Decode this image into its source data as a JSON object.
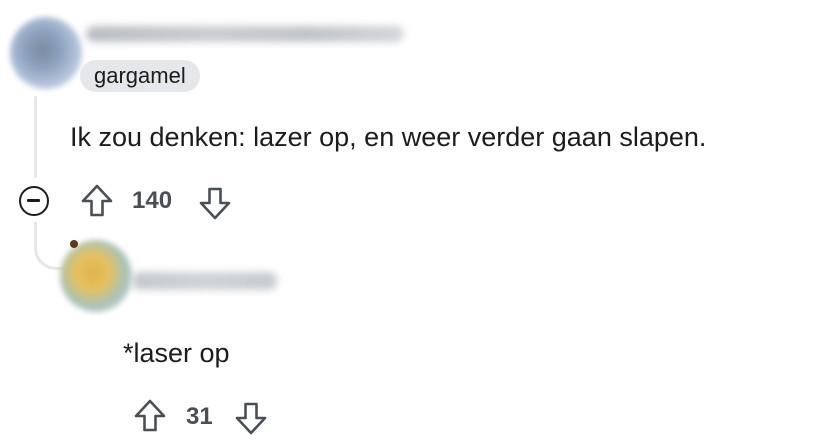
{
  "comments": [
    {
      "flair": "gargamel",
      "text": "Ik zou denken: lazer op, en weer verder gaan slapen.",
      "score": "140",
      "icons": {
        "upvote": "upvote-arrow-icon",
        "downvote": "downvote-arrow-icon",
        "collapse": "minus-circle-icon"
      }
    },
    {
      "text": "*laser op",
      "score": "31",
      "icons": {
        "upvote": "upvote-arrow-icon",
        "downvote": "downvote-arrow-icon"
      }
    }
  ],
  "colors": {
    "text": "#1c1c1c",
    "score": "#4a4f55",
    "thread_line": "#e5e7e9",
    "flair_bg": "#e5e7ea"
  }
}
